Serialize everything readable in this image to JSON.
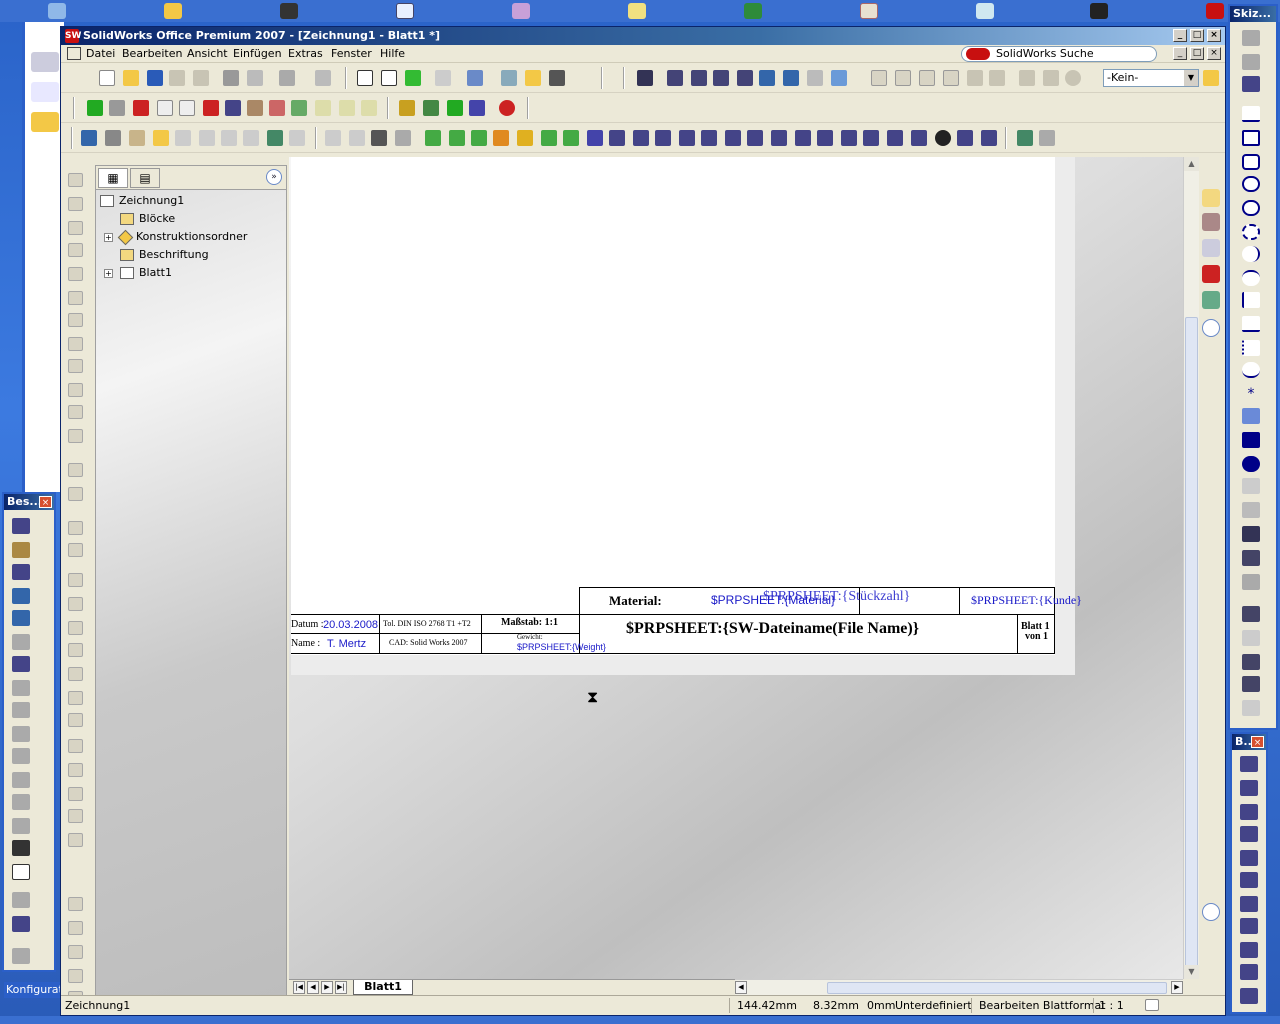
{
  "window": {
    "title": "SolidWorks Office Premium 2007 - [Zeichnung1 - Blatt1 *]",
    "logo_text": "SW"
  },
  "menu": [
    "Datei",
    "Bearbeiten",
    "Ansicht",
    "Einfügen",
    "Extras",
    "Fenster",
    "Hilfe"
  ],
  "search": {
    "label": "SolidWorks Suche"
  },
  "toolbar": {
    "config_value": "-Kein-"
  },
  "tree": {
    "root": "Zeichnung1",
    "items": [
      "Blöcke",
      "Konstruktionsordner",
      "Beschriftung",
      "Blatt1"
    ]
  },
  "title_block": {
    "material_label": "Material:",
    "material_value": "$PRPSHEET:{Material}",
    "overlap_text": "$PRPSHEET:{Stückzahl}",
    "kunde_value": "$PRPSHEET:{Kunde}",
    "file_name": "$PRPSHEET:{SW-Dateiname(File Name)}",
    "blatt": "Blatt 1",
    "von": "von 1",
    "datum_label": "Datum :",
    "datum_value": "20.03.2008",
    "name_label": "Name :",
    "name_value": "T. Mertz",
    "tol": "Tol. DIN ISO 2768 T1 +T2",
    "cad": "CAD: Solid Works 2007",
    "massstab": "Maßstab:  1:1",
    "gewicht_label": "Gewicht:",
    "gewicht_value": "$PRPSHEET:{Weight}"
  },
  "sheet_tab": "Blatt1",
  "status": {
    "doc": "Zeichnung1",
    "x": "144.42mm",
    "y": "8.32mm",
    "z": "0mm",
    "state": "Unterdefiniert",
    "mode": "Bearbeiten Blattformat",
    "scale": "1 : 1"
  },
  "palettes": {
    "left_title": "Bes...",
    "right_top_title": "Skiz...",
    "right_bottom_title": "B..."
  },
  "bottom_left_label": "Konfigurati",
  "colors": {
    "title_blue": "#0a246a",
    "accent_blue": "#2b5fc8",
    "property_blue": "#1a1ac8"
  }
}
